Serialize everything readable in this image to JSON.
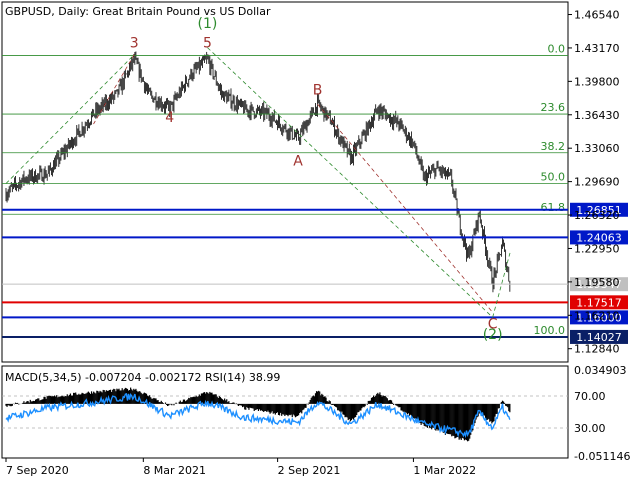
{
  "title": "GBPUSD, Daily:  Great Britain Pound vs US Dollar",
  "colors": {
    "candle": "#000000",
    "fib": "#2e8b2e",
    "wave_label_red": "#a0332f",
    "wave_label_green": "#2e8b2e",
    "blue_line": "#0018c8",
    "red_line": "#e00000",
    "current_price_bg": "#c0c0c0",
    "macd_hist": "#000000",
    "rsi_line": "#1e90ff",
    "grid": "#b0b0b0"
  },
  "chart_data": [
    {
      "type": "line",
      "title": "GBPUSD, Daily:  Great Britain Pound vs US Dollar",
      "ylim": [
        1.115,
        1.475
      ],
      "price_axis_ticks": [
        "1.46540",
        "1.43170",
        "1.39800",
        "1.36430",
        "1.33060",
        "1.29690",
        "1.26320",
        "1.22950",
        "1.19580",
        "1.16210",
        "1.12840"
      ],
      "time_axis_labels": [
        "7 Sep 2020",
        "8 Mar 2021",
        "2 Sep 2021",
        "1 Mar 2022"
      ],
      "x_range": [
        "2020-09-07",
        "2022-07-07"
      ],
      "price_series": [
        [
          "2020-09-07",
          1.285
        ],
        [
          "2020-10-01",
          1.3
        ],
        [
          "2020-11-01",
          1.305
        ],
        [
          "2020-12-01",
          1.335
        ],
        [
          "2021-01-01",
          1.365
        ],
        [
          "2021-02-01",
          1.385
        ],
        [
          "2021-02-24",
          1.42
        ],
        [
          "2021-03-15",
          1.385
        ],
        [
          "2021-04-12",
          1.37
        ],
        [
          "2021-05-10",
          1.405
        ],
        [
          "2021-06-01",
          1.42
        ],
        [
          "2021-06-20",
          1.385
        ],
        [
          "2021-07-20",
          1.37
        ],
        [
          "2021-08-20",
          1.365
        ],
        [
          "2021-09-29",
          1.34
        ],
        [
          "2021-10-25",
          1.375
        ],
        [
          "2021-11-10",
          1.36
        ],
        [
          "2021-12-08",
          1.32
        ],
        [
          "2022-01-13",
          1.37
        ],
        [
          "2022-02-10",
          1.355
        ],
        [
          "2022-03-01",
          1.335
        ],
        [
          "2022-03-15",
          1.3
        ],
        [
          "2022-04-01",
          1.31
        ],
        [
          "2022-04-20",
          1.3
        ],
        [
          "2022-05-01",
          1.255
        ],
        [
          "2022-05-13",
          1.22
        ],
        [
          "2022-05-27",
          1.265
        ],
        [
          "2022-06-14",
          1.195
        ],
        [
          "2022-06-27",
          1.235
        ],
        [
          "2022-07-07",
          1.193
        ]
      ],
      "fibonacci_levels": [
        {
          "label": "0.0",
          "price": 1.424
        },
        {
          "label": "23.6",
          "price": 1.365
        },
        {
          "label": "38.2",
          "price": 1.326
        },
        {
          "label": "50.0",
          "price": 1.295
        },
        {
          "label": "61.8",
          "price": 1.264
        },
        {
          "label": "100.0",
          "price": 1.14
        }
      ],
      "horizontal_levels": [
        {
          "label": "1.26851",
          "price": 1.26851,
          "color": "blue"
        },
        {
          "label": "1.24063",
          "price": 1.24063,
          "color": "blue"
        },
        {
          "label": "1.17517",
          "price": 1.17517,
          "color": "red"
        },
        {
          "label": "1.16000",
          "price": 1.16,
          "color": "blue"
        },
        {
          "label": "1.14027",
          "price": 1.14027,
          "color": "navy"
        }
      ],
      "current_price": "1.19347",
      "wave_labels": [
        {
          "text": "3",
          "date": "2021-02-24",
          "price": 1.432,
          "color": "red"
        },
        {
          "text": "(1)",
          "date": "2021-06-01",
          "price": 1.452,
          "color": "green"
        },
        {
          "text": "5",
          "date": "2021-06-01",
          "price": 1.432,
          "color": "red"
        },
        {
          "text": "4",
          "date": "2021-04-12",
          "price": 1.357,
          "color": "red"
        },
        {
          "text": "B",
          "date": "2021-10-25",
          "price": 1.385,
          "color": "red"
        },
        {
          "text": "A",
          "date": "2021-09-29",
          "price": 1.313,
          "color": "red"
        },
        {
          "text": "C",
          "date": "2022-06-14",
          "price": 1.149,
          "color": "red"
        },
        {
          "text": "(2)",
          "date": "2022-06-14",
          "price": 1.138,
          "color": "green"
        }
      ]
    },
    {
      "type": "area",
      "indicator_text": "MACD(5,34,5) -0.007204 -0.002172 RSI(14) 38.99",
      "ylim": [
        -0.05,
        0.035
      ],
      "axis_ticks": [
        "0.034903",
        "70.00",
        "30.00",
        "-0.051146"
      ],
      "rsi_levels": [
        70,
        30
      ],
      "macd_series": [
        [
          "2020-09-07",
          -0.002
        ],
        [
          "2020-11-01",
          0.006
        ],
        [
          "2021-01-01",
          0.011
        ],
        [
          "2021-02-24",
          0.014
        ],
        [
          "2021-04-12",
          -0.002
        ],
        [
          "2021-06-01",
          0.011
        ],
        [
          "2021-07-20",
          -0.004
        ],
        [
          "2021-09-29",
          -0.012
        ],
        [
          "2021-10-25",
          0.012
        ],
        [
          "2021-12-08",
          -0.016
        ],
        [
          "2022-01-13",
          0.011
        ],
        [
          "2022-03-15",
          -0.02
        ],
        [
          "2022-05-13",
          -0.035
        ],
        [
          "2022-05-27",
          -0.008
        ],
        [
          "2022-06-14",
          -0.018
        ],
        [
          "2022-06-27",
          0.004
        ],
        [
          "2022-07-07",
          -0.007
        ]
      ],
      "rsi_series": [
        [
          "2020-09-07",
          42
        ],
        [
          "2020-11-01",
          55
        ],
        [
          "2021-01-01",
          62
        ],
        [
          "2021-02-24",
          70
        ],
        [
          "2021-04-12",
          45
        ],
        [
          "2021-06-01",
          62
        ],
        [
          "2021-07-20",
          43
        ],
        [
          "2021-09-29",
          37
        ],
        [
          "2021-10-25",
          63
        ],
        [
          "2021-12-08",
          35
        ],
        [
          "2022-01-13",
          60
        ],
        [
          "2022-03-15",
          35
        ],
        [
          "2022-05-13",
          22
        ],
        [
          "2022-05-27",
          50
        ],
        [
          "2022-06-14",
          30
        ],
        [
          "2022-06-27",
          56
        ],
        [
          "2022-07-07",
          39
        ]
      ]
    }
  ]
}
